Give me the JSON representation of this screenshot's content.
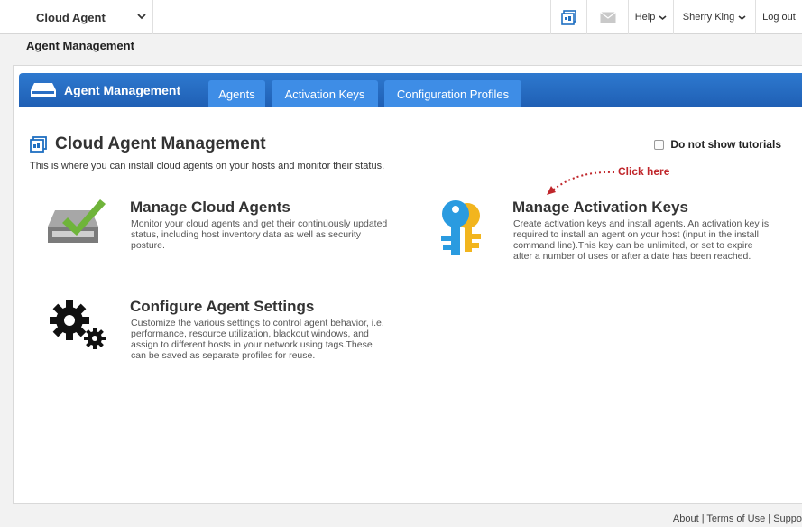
{
  "topbar": {
    "app_name": "Cloud Agent",
    "help": "Help",
    "user": "Sherry King",
    "logout": "Log out"
  },
  "breadcrumb": "Agent Management",
  "tabs": {
    "module_title": "Agent Management",
    "items": [
      "Agents",
      "Activation Keys",
      "Configuration Profiles"
    ]
  },
  "main": {
    "title": "Cloud Agent Management",
    "subtitle": "This is where you can install cloud agents on your hosts and monitor their status.",
    "tutorials_label": "Do not show tutorials",
    "click_here": "Click here",
    "cards": [
      {
        "title": "Manage Cloud Agents",
        "desc": "Monitor your cloud agents and get their continuously updated status, including host inventory data as well as security posture."
      },
      {
        "title": "Manage Activation Keys",
        "desc": "Create activation keys and install agents. An activation key is required to install an agent on your host (input in the install command line).This key can be unlimited, or set to expire after a number of uses or after a date has been reached."
      },
      {
        "title": "Configure Agent Settings",
        "desc": "Customize the various settings to control agent behavior, i.e. performance, resource utilization, blackout windows, and assign to different hosts in your network using tags.These can be saved as separate profiles for reuse."
      }
    ]
  },
  "footer": {
    "about": "About",
    "terms": "Terms of Use",
    "support": "Suppo"
  },
  "colors": {
    "tab_bar": "#1f5fb4",
    "tab": "#3e8de6",
    "accent_red": "#c0262b"
  }
}
